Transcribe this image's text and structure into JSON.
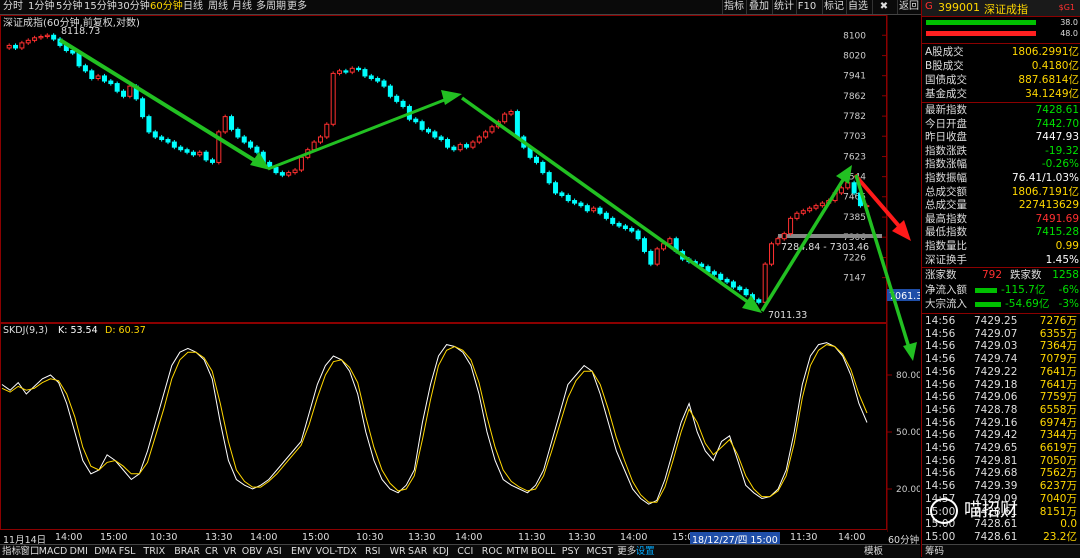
{
  "toolbar": {
    "timeframes": [
      "分时",
      "1分钟",
      "5分钟",
      "15分钟",
      "30分钟",
      "60分钟",
      "日线",
      "周线",
      "月线",
      "多周期",
      "更多"
    ],
    "active_timeframe": "60分钟",
    "tools": [
      "指标",
      "叠加",
      "统计",
      "F10",
      "标记",
      "自选",
      "返回"
    ]
  },
  "chart": {
    "title": "深证成指(60分钟,前复权,对数)",
    "high_label": "8118.73",
    "low_label": "7011.33",
    "range_label": "7284.84 - 7303.46",
    "current_price_tag": "7061.3",
    "price_axis": [
      "8100",
      "8020",
      "7941",
      "7862",
      "7782",
      "7703",
      "7623",
      "7544",
      "7465",
      "7385",
      "7306",
      "7226",
      "7147"
    ],
    "kdj_title": "SKDJ(9,3)",
    "kdj_k_label": "K: 53.54",
    "kdj_d_label": "D: 60.37",
    "kdj_axis": [
      "80.00",
      "50.00",
      "20.00"
    ],
    "time_axis": [
      "11月14日",
      "14:00",
      "15:00",
      "10:30",
      "13:30",
      "14:00",
      "15:00",
      "10:30",
      "13:30",
      "14:00",
      "11:30",
      "13:30",
      "14:00",
      "15:00",
      "11:30",
      "14:00"
    ],
    "highlighted_date": "18/12/27/四 15:00",
    "period_label": "60分钟",
    "colors": {
      "up": "#ff3030",
      "down": "#00ffff",
      "k_line": "#ffffff",
      "d_line": "#ffd700",
      "arrow_green": "#22c022",
      "arrow_red": "#ff1a1a"
    }
  },
  "chart_data": {
    "type": "candlestick",
    "title": "深证成指(60分钟,前复权,对数)",
    "ylim": [
      7000,
      8160
    ],
    "closes": [
      8060,
      8050,
      8070,
      8080,
      8090,
      8095,
      8100,
      8085,
      8060,
      8040,
      8030,
      7980,
      7960,
      7930,
      7940,
      7920,
      7910,
      7880,
      7860,
      7900,
      7850,
      7780,
      7720,
      7700,
      7690,
      7680,
      7660,
      7650,
      7640,
      7630,
      7640,
      7610,
      7600,
      7720,
      7780,
      7730,
      7700,
      7680,
      7660,
      7640,
      7600,
      7580,
      7560,
      7550,
      7560,
      7570,
      7620,
      7650,
      7680,
      7700,
      7750,
      7950,
      7960,
      7955,
      7970,
      7965,
      7940,
      7930,
      7920,
      7900,
      7860,
      7840,
      7820,
      7770,
      7760,
      7730,
      7720,
      7700,
      7690,
      7660,
      7650,
      7670,
      7660,
      7680,
      7700,
      7720,
      7740,
      7760,
      7790,
      7800,
      7700,
      7660,
      7620,
      7600,
      7560,
      7520,
      7480,
      7470,
      7450,
      7440,
      7430,
      7410,
      7420,
      7400,
      7380,
      7360,
      7350,
      7340,
      7330,
      7300,
      7250,
      7200,
      7260,
      7280,
      7300,
      7250,
      7220,
      7210,
      7200,
      7190,
      7170,
      7160,
      7140,
      7130,
      7110,
      7100,
      7080,
      7060,
      7050,
      7200,
      7280,
      7300,
      7320,
      7380,
      7400,
      7410,
      7420,
      7430,
      7440,
      7450,
      7480,
      7500,
      7520,
      7480,
      7430,
      7430
    ],
    "kdj_k": [
      75,
      72,
      76,
      70,
      74,
      78,
      80,
      76,
      65,
      50,
      35,
      28,
      30,
      38,
      35,
      30,
      25,
      28,
      40,
      55,
      70,
      85,
      92,
      94,
      92,
      88,
      78,
      55,
      35,
      25,
      22,
      20,
      22,
      25,
      30,
      35,
      40,
      45,
      60,
      75,
      85,
      90,
      88,
      82,
      70,
      50,
      35,
      25,
      20,
      18,
      22,
      30,
      55,
      75,
      90,
      96,
      95,
      92,
      85,
      70,
      50,
      35,
      25,
      22,
      20,
      18,
      22,
      30,
      45,
      60,
      75,
      80,
      85,
      82,
      70,
      55,
      40,
      30,
      20,
      15,
      12,
      14,
      25,
      40,
      55,
      65,
      50,
      40,
      35,
      45,
      48,
      35,
      22,
      18,
      15,
      16,
      20,
      30,
      50,
      75,
      90,
      96,
      97,
      95,
      90,
      80,
      65,
      55
    ],
    "kdj_d": [
      73,
      71,
      74,
      72,
      73,
      76,
      78,
      77,
      70,
      58,
      42,
      32,
      30,
      34,
      35,
      32,
      28,
      28,
      34,
      48,
      62,
      78,
      88,
      92,
      92,
      89,
      82,
      65,
      45,
      30,
      24,
      21,
      21,
      24,
      28,
      33,
      38,
      43,
      54,
      68,
      80,
      87,
      88,
      84,
      76,
      58,
      42,
      30,
      23,
      19,
      20,
      27,
      46,
      67,
      85,
      93,
      95,
      93,
      88,
      76,
      58,
      42,
      30,
      24,
      21,
      19,
      20,
      27,
      40,
      54,
      68,
      77,
      82,
      82,
      75,
      62,
      47,
      35,
      24,
      17,
      13,
      13,
      21,
      35,
      50,
      62,
      55,
      44,
      38,
      42,
      46,
      38,
      27,
      20,
      16,
      16,
      19,
      27,
      44,
      68,
      85,
      93,
      96,
      95,
      91,
      83,
      70,
      60
    ]
  },
  "right_panel": {
    "header": {
      "code": "399001",
      "name": "深证成指",
      "prefix": "G",
      "tag": "$G1"
    },
    "bar1": "38.0",
    "bar2": "48.0",
    "stats": [
      {
        "label": "A股成交",
        "value": "1806.2991亿",
        "color": "#ffd700"
      },
      {
        "label": "B股成交",
        "value": "0.4180亿",
        "color": "#ffd700"
      },
      {
        "label": "国债成交",
        "value": "887.6814亿",
        "color": "#ffd700"
      },
      {
        "label": "基金成交",
        "value": "34.1249亿",
        "color": "#ffd700"
      }
    ],
    "quote": [
      {
        "label": "最新指数",
        "value": "7428.61",
        "color": "#00e000"
      },
      {
        "label": "今日开盘",
        "value": "7442.70",
        "color": "#00e000"
      },
      {
        "label": "昨日收盘",
        "value": "7447.93",
        "color": "#ffffff"
      },
      {
        "label": "指数涨跌",
        "value": "-19.32",
        "color": "#00e000"
      },
      {
        "label": "指数涨幅",
        "value": "-0.26%",
        "color": "#00e000"
      },
      {
        "label": "指数振幅",
        "value": "76.41/1.03%",
        "color": "#ffffff"
      },
      {
        "label": "总成交额",
        "value": "1806.7191亿",
        "color": "#ffd700"
      },
      {
        "label": "总成交量",
        "value": "227413629",
        "color": "#ffd700"
      },
      {
        "label": "最高指数",
        "value": "7491.69",
        "color": "#ff3030"
      },
      {
        "label": "最低指数",
        "value": "7415.28",
        "color": "#00e000"
      },
      {
        "label": "指数量比",
        "value": "0.99",
        "color": "#ffd700"
      },
      {
        "label": "深证换手",
        "value": "1.45%",
        "color": "#ffffff"
      }
    ],
    "updown": {
      "up_label": "涨家数",
      "up_value": "792",
      "down_label": "跌家数",
      "down_value": "1258"
    },
    "flows": [
      {
        "label": "净流入额",
        "value": "-115.7亿",
        "pct": "-6%"
      },
      {
        "label": "大宗流入",
        "value": "-54.69亿",
        "pct": "-3%"
      }
    ],
    "ticks": [
      {
        "t": "14:56",
        "p": "7429.25",
        "v": "7276万"
      },
      {
        "t": "14:56",
        "p": "7429.07",
        "v": "6355万"
      },
      {
        "t": "14:56",
        "p": "7429.03",
        "v": "7364万"
      },
      {
        "t": "14:56",
        "p": "7429.74",
        "v": "7079万"
      },
      {
        "t": "14:56",
        "p": "7429.22",
        "v": "7641万"
      },
      {
        "t": "14:56",
        "p": "7429.18",
        "v": "7641万"
      },
      {
        "t": "14:56",
        "p": "7429.06",
        "v": "7759万"
      },
      {
        "t": "14:56",
        "p": "7428.78",
        "v": "6558万"
      },
      {
        "t": "14:56",
        "p": "7429.16",
        "v": "6974万"
      },
      {
        "t": "14:56",
        "p": "7429.42",
        "v": "7344万"
      },
      {
        "t": "14:56",
        "p": "7429.65",
        "v": "6619万"
      },
      {
        "t": "14:56",
        "p": "7429.81",
        "v": "7050万"
      },
      {
        "t": "14:56",
        "p": "7429.68",
        "v": "7562万"
      },
      {
        "t": "14:56",
        "p": "7429.39",
        "v": "6237万"
      },
      {
        "t": "14:57",
        "p": "7429.09",
        "v": "7040万"
      },
      {
        "t": "15:00",
        "p": "7428.61",
        "v": "8151万"
      },
      {
        "t": "15:00",
        "p": "7428.61",
        "v": "0.0"
      },
      {
        "t": "15:00",
        "p": "7428.61",
        "v": "23.2亿"
      }
    ],
    "bottom_tab": "筹码"
  },
  "bottom": {
    "indicators": [
      "指标",
      "窗口",
      "MACD",
      "DMI",
      "DMA",
      "FSL",
      "TRIX",
      "BRAR",
      "CR",
      "VR",
      "OBV",
      "ASI",
      "EMV",
      "VOL-TDX",
      "RSI",
      "WR",
      "SAR",
      "KDJ",
      "CCI",
      "ROC",
      "MTM",
      "BOLL",
      "PSY",
      "MCST",
      "更多",
      "设置"
    ],
    "active": "设置",
    "right_tab": "模板"
  },
  "watermark": "喵招财"
}
